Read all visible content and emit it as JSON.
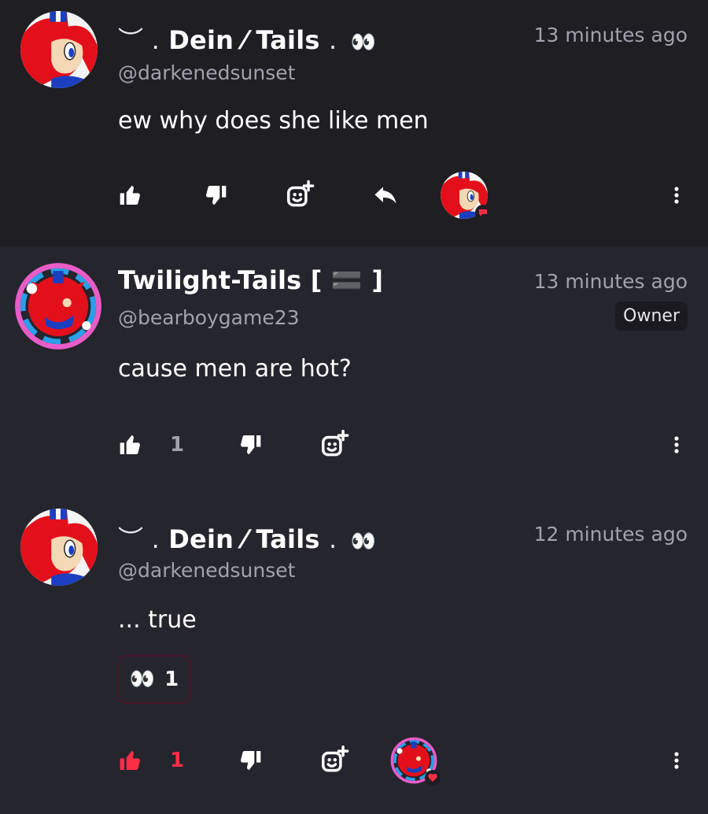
{
  "comments": [
    {
      "author": {
        "name_prefix": "︶ .",
        "name": "Dein ⁄ Tails",
        "name_suffix": ".",
        "emoji": "👀",
        "handle": "@darkenedsunset"
      },
      "time": "13 minutes ago",
      "text": "ew why does she like men",
      "actions": {
        "like_icon": "thumbs-up-icon",
        "dislike_icon": "thumbs-down-icon",
        "react_icon": "add-reaction-icon",
        "reply_icon": "reply-icon",
        "more_icon": "more-vertical-icon"
      },
      "liked_by_badge": "speech-bubble"
    },
    {
      "author": {
        "name": "Twilight-Tails [ 🟰 ]",
        "handle": "@bearboygame23"
      },
      "badge": "Owner",
      "time": "13 minutes ago",
      "text": "cause men are hot?",
      "likes": "1",
      "actions": {
        "like_icon": "thumbs-up-icon",
        "dislike_icon": "thumbs-down-icon",
        "react_icon": "add-reaction-icon",
        "more_icon": "more-vertical-icon"
      }
    },
    {
      "author": {
        "name_prefix": "︶ .",
        "name": "Dein ⁄ Tails",
        "name_suffix": ".",
        "emoji": "👀",
        "handle": "@darkenedsunset"
      },
      "time": "12 minutes ago",
      "text": "... true",
      "reaction": {
        "emoji": "👀",
        "count": "1"
      },
      "likes": "1",
      "liked": true,
      "actions": {
        "like_icon": "thumbs-up-icon",
        "dislike_icon": "thumbs-down-icon",
        "react_icon": "add-reaction-icon",
        "more_icon": "more-vertical-icon"
      },
      "liked_by_badge": "heart"
    }
  ],
  "colors": {
    "background_top": "#1e1e23",
    "background": "#25252d",
    "text": "#ffffff",
    "muted": "#a2a2ad",
    "like_active": "#ff2d46",
    "reaction_border": "#4a1528"
  }
}
